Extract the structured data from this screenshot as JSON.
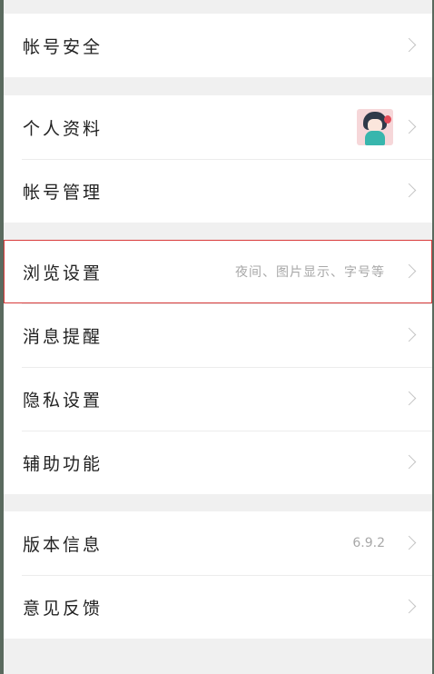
{
  "settings": {
    "account_security": "帐号安全",
    "profile": "个人资料",
    "account_management": "帐号管理",
    "browse_settings": "浏览设置",
    "browse_settings_hint": "夜间、图片显示、字号等",
    "message_reminders": "消息提醒",
    "privacy_settings": "隐私设置",
    "accessibility": "辅助功能",
    "version_info": "版本信息",
    "version_number": "6.9.2",
    "feedback": "意见反馈"
  },
  "colors": {
    "highlight_border": "#d83a3a",
    "hint_text": "#a8a8a8"
  },
  "icons": {
    "row_arrow": "chevron-right-icon",
    "avatar": "user-avatar"
  }
}
